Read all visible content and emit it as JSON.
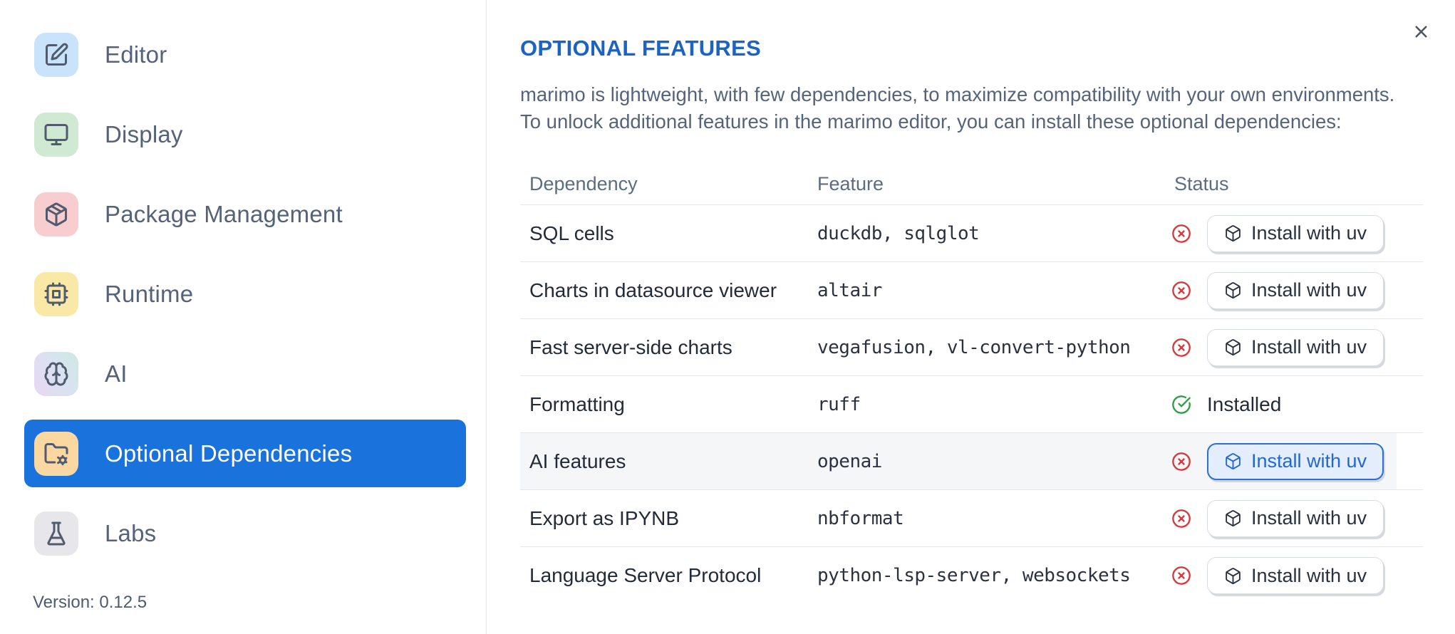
{
  "sidebar": {
    "items": [
      {
        "id": "editor",
        "label": "Editor",
        "icon": "square-pen",
        "icon_bg": "#c8e3fa",
        "selected": false
      },
      {
        "id": "display",
        "label": "Display",
        "icon": "monitor",
        "icon_bg": "#cfe9d3",
        "selected": false
      },
      {
        "id": "package-management",
        "label": "Package Management",
        "icon": "package",
        "icon_bg": "#f8cdd0",
        "selected": false
      },
      {
        "id": "runtime",
        "label": "Runtime",
        "icon": "cpu",
        "icon_bg": "#fae8a6",
        "selected": false
      },
      {
        "id": "ai",
        "label": "AI",
        "icon": "brain",
        "icon_bg": "linear-gradient(60deg,#e9d8f3 0%,#d9e2f1 55%,#cdeae2 100%)",
        "selected": false
      },
      {
        "id": "optional-dependencies",
        "label": "Optional Dependencies",
        "icon": "folder-cog",
        "icon_bg": "#fbd8a2",
        "selected": true
      },
      {
        "id": "labs",
        "label": "Labs",
        "icon": "flask",
        "icon_bg": "#e7e7eb",
        "selected": false
      }
    ],
    "version": "Version: 0.12.5"
  },
  "panel": {
    "title": "OPTIONAL FEATURES",
    "description_line1": "marimo is lightweight, with few dependencies, to maximize compatibility with your own environments.",
    "description_line2": "To unlock additional features in the marimo editor, you can install these optional dependencies:"
  },
  "table": {
    "headers": [
      "Dependency",
      "Feature",
      "Status"
    ],
    "installed_label": "Installed",
    "rows": [
      {
        "dependency": "SQL cells",
        "feature": "duckdb, sqlglot",
        "status": "missing",
        "action": "Install with uv",
        "highlighted": false
      },
      {
        "dependency": "Charts in datasource viewer",
        "feature": "altair",
        "status": "missing",
        "action": "Install with uv",
        "highlighted": false
      },
      {
        "dependency": "Fast server-side charts",
        "feature": "vegafusion, vl-convert-python",
        "status": "missing",
        "action": "Install with uv",
        "highlighted": false
      },
      {
        "dependency": "Formatting",
        "feature": "ruff",
        "status": "installed",
        "action": null,
        "highlighted": false
      },
      {
        "dependency": "AI features",
        "feature": "openai",
        "status": "missing",
        "action": "Install with uv",
        "highlighted": true
      },
      {
        "dependency": "Export as IPYNB",
        "feature": "nbformat",
        "status": "missing",
        "action": "Install with uv",
        "highlighted": false
      },
      {
        "dependency": "Language Server Protocol",
        "feature": "python-lsp-server, websockets",
        "status": "missing",
        "action": "Install with uv",
        "highlighted": false
      }
    ]
  },
  "colors": {
    "accent_blue": "#1a72dd",
    "title_blue": "#1b63c5",
    "error_red": "#d63939",
    "success_green": "#2f9e44",
    "button_active_border": "#2b6fd4",
    "button_active_bg": "#e3edfb",
    "button_active_text": "#2368cd"
  }
}
